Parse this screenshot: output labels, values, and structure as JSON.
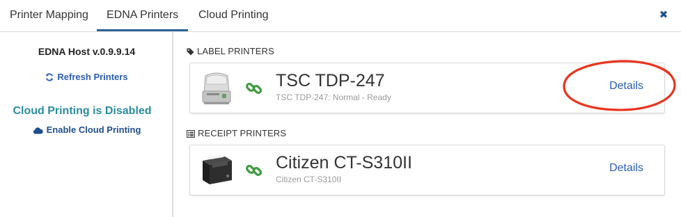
{
  "tabs": [
    {
      "label": "Printer Mapping",
      "active": false
    },
    {
      "label": "EDNA Printers",
      "active": true
    },
    {
      "label": "Cloud Printing",
      "active": false
    }
  ],
  "close_icon": "close-icon",
  "sidebar": {
    "host_version": "EDNA Host v.0.9.9.14",
    "refresh_label": "Refresh Printers",
    "refresh_icon": "refresh-icon",
    "cloud_status": "Cloud Printing is Disabled",
    "enable_cloud_label": "Enable Cloud Printing",
    "cloud_icon": "cloud-icon"
  },
  "sections": {
    "label_printers": {
      "heading": "LABEL PRINTERS",
      "icon": "tag-icon",
      "printers": [
        {
          "name": "TSC TDP-247",
          "status": "TSC TDP-247: Normal - Ready",
          "details_label": "Details"
        }
      ]
    },
    "receipt_printers": {
      "heading": "RECEIPT PRINTERS",
      "icon": "list-icon",
      "printers": [
        {
          "name": "Citizen CT-S310II",
          "status": "Citizen CT-S310II",
          "details_label": "Details"
        }
      ]
    }
  },
  "colors": {
    "accent_blue": "#2a5db0",
    "status_teal": "#2a8c9c",
    "link_green": "#3c9a3c",
    "annotation_red": "#e8341c"
  }
}
